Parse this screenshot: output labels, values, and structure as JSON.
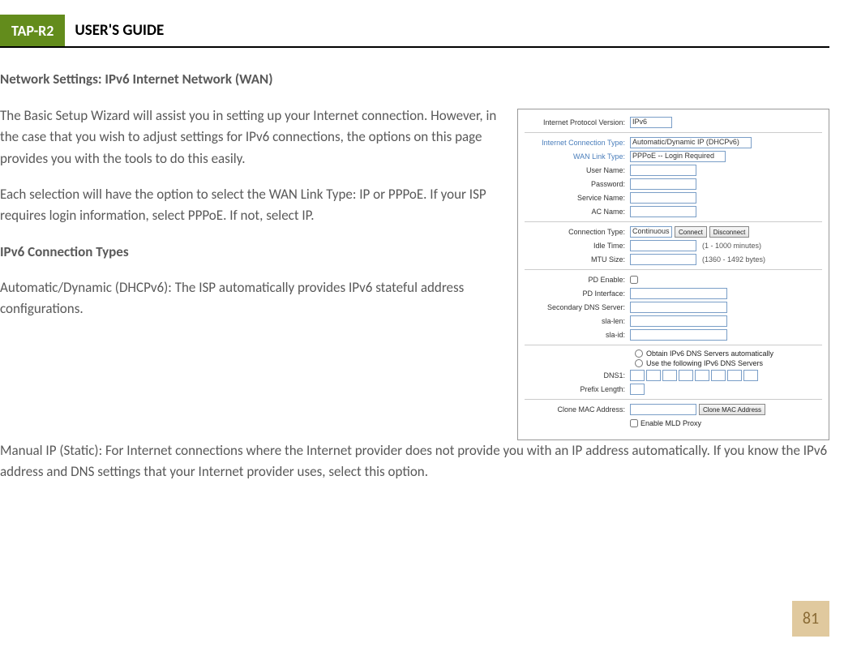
{
  "header": {
    "badge": "TAP-R2",
    "title": "USER'S GUIDE"
  },
  "section_title": "Network Settings: IPv6 Internet Network (WAN)",
  "paragraphs": {
    "p1": "The Basic Setup Wizard will assist you in setting up your Internet connection.  However, in the case that you wish to adjust settings for IPv6 connections, the options on this page provides you with the tools to do this easily.",
    "p2": "Each selection will have the option to select the WAN Link Type:  IP or PPPoE. If your ISP requires login information, select PPPoE.  If not, select IP.",
    "sub": "IPv6 Connection Types",
    "p3": "Automatic/Dynamic (DHCPv6): The ISP automatically provides IPv6 stateful address configurations.",
    "p4": "Manual IP (Static): For Internet connections where the Internet provider does not provide you with an IP address automatically.  If you know the IPv6 address and DNS settings that your Internet provider uses, select this option."
  },
  "config": {
    "labels": {
      "ipv": "Internet Protocol Version:",
      "ict": "Internet Connection Type:",
      "wlt": "WAN Link Type:",
      "user": "User Name:",
      "pass": "Password:",
      "svc": "Service Name:",
      "ac": "AC Name:",
      "ctype": "Connection Type:",
      "idle": "Idle Time:",
      "mtu": "MTU Size:",
      "pde": "PD Enable:",
      "pdi": "PD Interface:",
      "sdns": "Secondary DNS Server:",
      "slalen": "sla-len:",
      "slaid": "sla-id:",
      "dns1": "DNS1:",
      "plen": "Prefix Length:",
      "clone": "Clone MAC Address:"
    },
    "values": {
      "ipv": "IPv6",
      "ict": "Automatic/Dynamic IP (DHCPv6)",
      "wlt": "PPPoE -- Login Required",
      "ctype": "Continuous",
      "connect_btn": "Connect",
      "disconnect_btn": "Disconnect",
      "idle_hint": "(1 - 1000 minutes)",
      "mtu_hint": "(1360 - 1492 bytes)",
      "radio_auto": "Obtain IPv6 DNS Servers automatically",
      "radio_manual": "Use the following IPv6 DNS Servers",
      "clone_btn": "Clone MAC Address",
      "mld": "Enable MLD Proxy"
    }
  },
  "page_number": "81"
}
